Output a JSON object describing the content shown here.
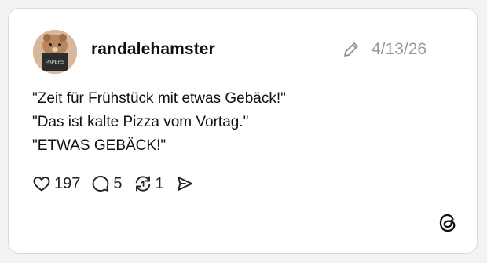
{
  "post": {
    "username": "randalehamster",
    "date": "4/13/26",
    "lines": [
      "\"Zeit für Frühstück mit etwas Gebäck!\"",
      "\"Das ist kalte Pizza vom Vortag.\"",
      "\"ETWAS GEBÄCK!\""
    ],
    "avatar_label": "PAPERS"
  },
  "actions": {
    "likes": "197",
    "comments": "5",
    "reposts": "1"
  },
  "icons": {
    "edit": "pencil-icon",
    "like": "heart-icon",
    "comment": "speech-bubble-icon",
    "repost": "repost-icon",
    "share": "send-icon",
    "brand": "threads-logo-icon"
  },
  "colors": {
    "card_background": "#ffffff",
    "page_background": "#f3f3f3",
    "text": "#101010",
    "muted": "#999999"
  }
}
